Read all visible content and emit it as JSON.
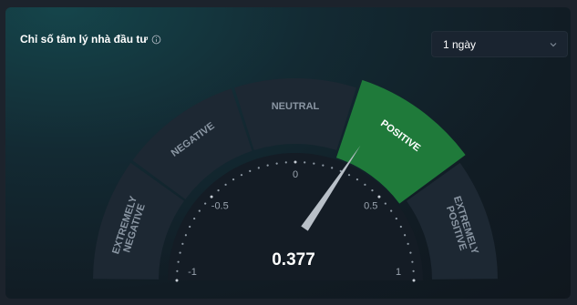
{
  "widget": {
    "title": "Chỉ số tâm lý nhà đầu tư",
    "info_icon": "info-circle-icon"
  },
  "timeframe": {
    "selected": "1 ngày",
    "icon": "chevron-down-icon"
  },
  "gauge": {
    "value": 0.377,
    "value_label": "0.377",
    "min": -1,
    "max": 1,
    "ticks": [
      {
        "label": "-1"
      },
      {
        "label": "-0.5"
      },
      {
        "label": "0"
      },
      {
        "label": "0.5"
      },
      {
        "label": "1"
      }
    ],
    "zones": [
      {
        "label_lines": [
          "EXTREMELY",
          "NEGATIVE"
        ],
        "from": -1,
        "to": -0.6,
        "active": false
      },
      {
        "label_lines": [
          "NEGATIVE"
        ],
        "from": -0.6,
        "to": -0.2,
        "active": false
      },
      {
        "label_lines": [
          "NEUTRAL"
        ],
        "from": -0.2,
        "to": 0.2,
        "active": false
      },
      {
        "label_lines": [
          "POSITIVE"
        ],
        "from": 0.2,
        "to": 0.6,
        "active": true
      },
      {
        "label_lines": [
          "EXTREMELY",
          "POSITIVE"
        ],
        "from": 0.6,
        "to": 1,
        "active": false
      }
    ],
    "colors": {
      "zone": "#1d2833",
      "active_zone": "#1f7a3a",
      "zone_text": "#8a96a3",
      "active_text": "#ffffff",
      "needle": "#b9c0c8"
    }
  }
}
